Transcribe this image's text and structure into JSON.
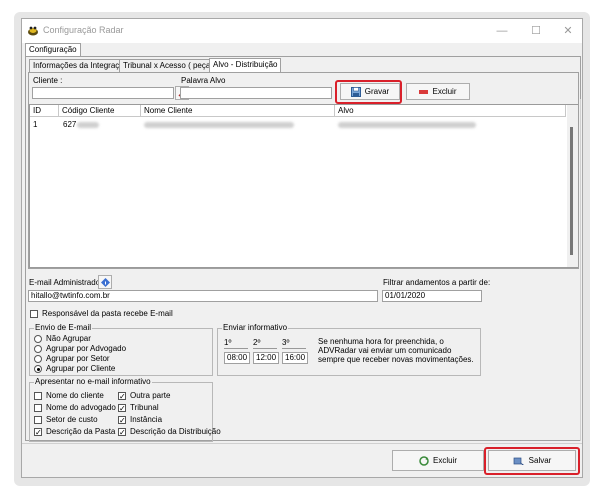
{
  "window": {
    "title": "Configuração Radar",
    "minimize": "—",
    "maximize": "☐",
    "close": "✕"
  },
  "tabs_outer": [
    "Configuração"
  ],
  "tabs_inner": [
    "Informações da Integração",
    "Tribunal x Acesso ( peças )",
    "Alvo - Distribuição"
  ],
  "form": {
    "cliente_label": "Cliente :",
    "palavra_alvo_label": "Palavra Alvo",
    "gravar_label": "Gravar",
    "excluir_label": "Excluir"
  },
  "grid": {
    "headers": [
      "ID",
      "Código Cliente",
      "Nome Cliente",
      "Alvo"
    ],
    "rows": [
      {
        "id": "1",
        "codigo": "627"
      }
    ]
  },
  "email": {
    "admin_label": "E-mail Administrador",
    "admin_value": "hitallo@twtinfo.com.br",
    "filtrar_label": "Filtrar andamentos a partir de:",
    "filtrar_value": "01/01/2020",
    "responsavel_label": "Responsável da pasta recebe E-mail"
  },
  "envio": {
    "title": "Envio de E-mail",
    "options": [
      "Não Agrupar",
      "Agrupar por Advogado",
      "Agrupar por Setor",
      "Agrupar por Cliente"
    ],
    "selected": 3
  },
  "informativo": {
    "title": "Enviar informativo",
    "headers": [
      "1º",
      "2º",
      "3º"
    ],
    "times": [
      "08:00",
      "12:00",
      "16:00"
    ],
    "note": "Se nenhuma hora for preenchida, o ADVRadar vai enviar um comunicado sempre que receber novas movimentações."
  },
  "apresentar": {
    "title": "Apresentar no e-mail informativo",
    "left": [
      {
        "label": "Nome do cliente",
        "checked": false
      },
      {
        "label": "Nome do advogado",
        "checked": false
      },
      {
        "label": "Setor de custo",
        "checked": false
      },
      {
        "label": "Descrição da Pasta",
        "checked": true
      }
    ],
    "right": [
      {
        "label": "Outra parte",
        "checked": true
      },
      {
        "label": "Tribunal",
        "checked": true
      },
      {
        "label": "Instância",
        "checked": true
      },
      {
        "label": "Descrição da Distribuição",
        "checked": true
      }
    ]
  },
  "footer": {
    "excluir_label": "Excluir",
    "salvar_label": "Salvar"
  },
  "colors": {
    "highlight": "#d9202a",
    "window_bg": "#f0f0f0"
  }
}
